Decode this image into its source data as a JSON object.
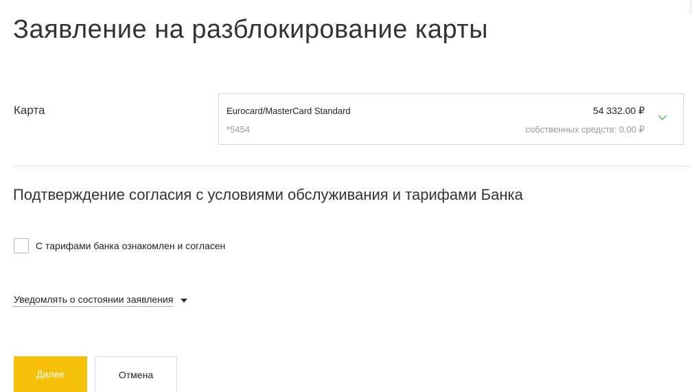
{
  "page": {
    "title": "Заявление на разблокирование карты"
  },
  "card_field": {
    "label": "Карта",
    "card_name": "Eurocard/MasterCard Standard",
    "card_number": "*5454",
    "balance": "54 332.00 ₽",
    "own_funds": "собственных средств: 0.00 ₽",
    "chevron_icon": "chevron-down-icon",
    "chevron_color": "#4caf50"
  },
  "agreement": {
    "heading": "Подтверждение согласия с условиями обслуживания и тарифами Банка",
    "checkbox_label": "С тарифами банка ознакомлен и согласен",
    "checked": false
  },
  "notification": {
    "label": "Уведомлять о состоянии заявления",
    "arrow_icon": "caret-down-icon"
  },
  "actions": {
    "next_label": "Далее",
    "cancel_label": "Отмена",
    "accent_color": "#f8c109"
  }
}
